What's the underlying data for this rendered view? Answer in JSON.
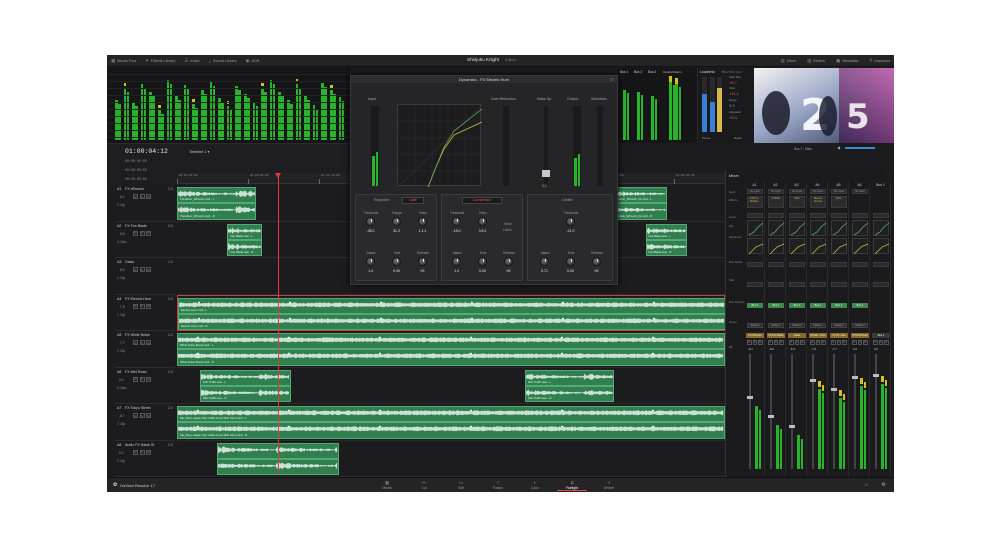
{
  "top_bar": {
    "left_items": [
      {
        "icon": "media-pool-icon",
        "label": "Media Pool"
      },
      {
        "icon": "effects-library-icon",
        "label": "Effects Library"
      },
      {
        "icon": "index-icon",
        "label": "Index"
      },
      {
        "icon": "sound-library-icon",
        "label": "Sound Library"
      },
      {
        "icon": "adr-icon",
        "label": "ADR"
      }
    ],
    "project_title": "Shinjuku Knight",
    "project_status": "Edited",
    "right_items": [
      {
        "icon": "mixer-icon",
        "label": "Mixer"
      },
      {
        "icon": "meters-icon",
        "label": "Meters"
      },
      {
        "icon": "metadata-icon",
        "label": "Metadata"
      },
      {
        "icon": "inspector-icon",
        "label": "Inspector"
      }
    ]
  },
  "timecode": {
    "main": "01:00:04:12",
    "timeline_label": "Timeline 1",
    "rows": [
      "00:00:00:00",
      "00:00:00:00",
      "00:00:00:00"
    ]
  },
  "ruler_ticks": [
    "01:00:00:00",
    "01:00:05:00",
    "01:00:10:00",
    "01:00:15:00",
    "01:00:20:00",
    "01:00:25:00",
    "01:00:30:00",
    "01:00:35:00",
    "01:00:40:00"
  ],
  "bus_labels": [
    "Bus 1",
    "Bus 2",
    "Bus 3",
    "Control Room"
  ],
  "loudness": {
    "title": "Loudness",
    "standard": "BS.1770-1 (LU)",
    "short_max_label": "Short Max",
    "short_max": "+8.7",
    "short_label": "Short",
    "short": "+11.2",
    "range_label": "Range",
    "range": "3.9",
    "integrated_label": "Integrated",
    "integrated": "+9.4",
    "pause": "Pause",
    "reset": "Reset"
  },
  "viewer_text": "Bus 1 · Main",
  "dynamics": {
    "title": "Dynamics - FX Electric Hum",
    "labels": {
      "input": "Input",
      "gain_reduction": "Gain Reduction",
      "make_up": "Make Up",
      "output": "Output",
      "sidechain": "Sidechain"
    },
    "makeup_value": "0.0",
    "sections": {
      "expander": {
        "title": "Expander",
        "gate": "Gate",
        "knobs": [
          {
            "label": "Threshold",
            "value": "-35.0"
          },
          {
            "label": "Range",
            "value": "31.2"
          },
          {
            "label": "Ratio",
            "value": "1.1:1"
          }
        ],
        "knobs2": [
          {
            "label": "Attack",
            "value": "1.4"
          },
          {
            "label": "Hold",
            "value": "0.00"
          },
          {
            "label": "Release",
            "value": "93"
          }
        ]
      },
      "compressor": {
        "title": "Compressor",
        "knobs": [
          {
            "label": "Threshold",
            "value": "-15.0"
          },
          {
            "label": "Ratio",
            "value": "3.5:1"
          }
        ],
        "send_label": "Send",
        "listen_label": "Listen",
        "knobs2": [
          {
            "label": "Attack",
            "value": "1.4"
          },
          {
            "label": "Hold",
            "value": "0.00"
          },
          {
            "label": "Release",
            "value": "93"
          }
        ]
      },
      "limiter": {
        "title": "Limiter",
        "knobs": [
          {
            "label": "Threshold",
            "value": "-21.0"
          }
        ],
        "knobs2": [
          {
            "label": "Attack",
            "value": "0.71"
          },
          {
            "label": "Hold",
            "value": "0.00"
          },
          {
            "label": "Release",
            "value": "93"
          }
        ]
      }
    }
  },
  "tracks": [
    {
      "id": "A1",
      "name": "FX Whoosh",
      "vol": "-8.1",
      "clips_label": "1 Clip",
      "ch": "2.0",
      "clips": [
        {
          "name": "Transition_Whoosh.mp3 - L",
          "start": 0,
          "end": 14.5,
          "half": "top"
        },
        {
          "name": "Transition_Whoosh.mp3 - R",
          "start": 0,
          "end": 14.5,
          "half": "bottom"
        },
        {
          "name": "Transition_Whoosh_02.mp3 - L",
          "start": 79,
          "end": 89.5,
          "half": "top"
        },
        {
          "name": "Transition_Whoosh_02.mp3 - R",
          "start": 79,
          "end": 89.5,
          "half": "bottom"
        }
      ]
    },
    {
      "id": "A2",
      "name": "FX Fan Blade",
      "vol": "-8.9",
      "clips_label": "4 Clips",
      "ch": "2.0",
      "clips": [
        {
          "name": "Fan Blade.wav - L",
          "start": 9.2,
          "end": 15.6,
          "half": "top"
        },
        {
          "name": "Fan Blade.wav - R",
          "start": 9.2,
          "end": 15.6,
          "half": "bottom"
        },
        {
          "name": "Fan Blade.wav - L",
          "start": 85.5,
          "end": 93,
          "half": "top"
        },
        {
          "name": "Fan Blade.wav - R",
          "start": 85.5,
          "end": 93,
          "half": "bottom"
        }
      ]
    },
    {
      "id": "A3",
      "name": "Glass",
      "vol": "-8.9",
      "clips_label": "1 Clip",
      "ch": "1.0",
      "clips": []
    },
    {
      "id": "A4",
      "name": "FX Electric Hum",
      "vol": "-7.8",
      "clips_label": "1 Clip",
      "ch": "2.0",
      "clips": [
        {
          "name": "Electric Hum.mp3 - L",
          "start": 0,
          "end": 100,
          "half": "top"
        },
        {
          "name": "Electric Hum.mp3 - R",
          "start": 0,
          "end": 100,
          "half": "bottom"
        }
      ]
    },
    {
      "id": "A5",
      "name": "FX White Noise",
      "vol": "-7.7",
      "clips_label": "1 Clip",
      "ch": "2.0",
      "clips": [
        {
          "name": "White Noise Boost.mp3 - L",
          "start": 0,
          "end": 100,
          "half": "top"
        },
        {
          "name": "White Noise Boost.mp3 - R",
          "start": 0,
          "end": 100,
          "half": "bottom"
        }
      ]
    },
    {
      "id": "A6",
      "name": "FX Wet Road",
      "vol": "0.0",
      "clips_label": "2 Clips",
      "ch": "2.0",
      "clips": [
        {
          "name": "Wet Traffic.wav - L",
          "start": 4.2,
          "end": 20.8,
          "half": "top"
        },
        {
          "name": "Wet Traffic.wav - R",
          "start": 4.2,
          "end": 20.8,
          "half": "bottom"
        },
        {
          "name": "Wet Traffic.wav - L",
          "start": 63.5,
          "end": 79.8,
          "half": "top"
        },
        {
          "name": "Wet Traffic.wav - R",
          "start": 63.5,
          "end": 79.8,
          "half": "bottom"
        }
      ]
    },
    {
      "id": "A7",
      "name": "FX Tokyo Street",
      "vol": "-6.7",
      "clips_label": "1 Clip",
      "ch": "2.0",
      "clips": [
        {
          "name": "SE_Tokyo Japan City Traffic Amos With Siren.mp3 - L",
          "start": 0,
          "end": 100,
          "half": "top"
        },
        {
          "name": "SE_Tokyo Japan City Traffic Amos With Siren.mp3 - R",
          "start": 0,
          "end": 100,
          "half": "bottom"
        }
      ]
    },
    {
      "id": "A8",
      "name": "Audio FX Hawk St",
      "vol": "0.0",
      "clips_label": "1 Clip",
      "ch": "2.0",
      "clips": [
        {
          "name": "",
          "start": 7.3,
          "end": 29.5,
          "half": "top"
        },
        {
          "name": "",
          "start": 7.3,
          "end": 29.5,
          "half": "bottom"
        }
      ]
    }
  ],
  "mixer": {
    "title": "Mixer",
    "row_labels": [
      "Input",
      "Effects",
      "Insert",
      "EQ",
      "Dynamics",
      "Bus Sends",
      "Pan",
      "Bus Outputs",
      "Group",
      "dB"
    ],
    "strips": [
      {
        "id": "A1",
        "input": "No Input",
        "effect": "AirDrop... Multiba...",
        "bus": "Bus 1",
        "group": "Group 1",
        "name": "FX Whoosh",
        "db": "-8.1",
        "level": 0.55
      },
      {
        "id": "A2",
        "input": "No Input",
        "effect": "AirFilter",
        "bus": "Bus 1",
        "group": "Group 1",
        "name": "FX Fan Blade",
        "db": "-8.9",
        "level": 0.38
      },
      {
        "id": "A3",
        "input": "No Input",
        "effect": "Pitch",
        "bus": "Bus 1",
        "group": "Group 1",
        "name": "Glass",
        "db": "-8.9",
        "level": 0.3
      },
      {
        "id": "A4",
        "input": "No Input",
        "effect": "Reverb Chorus",
        "bus": "Bus 1",
        "group": "Group 1",
        "name": "FX Ele...Hum",
        "db": "-7.8",
        "level": 0.7
      },
      {
        "id": "A5",
        "input": "No Input",
        "effect": "Echo",
        "bus": "Bus 1",
        "group": "Group 1",
        "name": "FX W...oise",
        "db": "-7.7",
        "level": 0.62
      },
      {
        "id": "A6",
        "input": "No Input",
        "effect": "",
        "bus": "Bus 1",
        "group": "Group 1",
        "name": "FX Wet Road",
        "db": "0.0",
        "level": 0.72
      },
      {
        "id": "Bus 1",
        "input": "",
        "effect": "",
        "bus": "",
        "group": "",
        "name": "Bus 1",
        "db": "0.0",
        "level": 0.74
      }
    ]
  },
  "pages": [
    {
      "icon": "media-page-icon",
      "label": "Media"
    },
    {
      "icon": "cut-page-icon",
      "label": "Cut"
    },
    {
      "icon": "edit-page-icon",
      "label": "Edit"
    },
    {
      "icon": "fusion-page-icon",
      "label": "Fusion"
    },
    {
      "icon": "color-page-icon",
      "label": "Color"
    },
    {
      "icon": "fairlight-page-icon",
      "label": "Fairlight",
      "active": true
    },
    {
      "icon": "deliver-page-icon",
      "label": "Deliver"
    }
  ],
  "brand": "DaVinci Resolve 17",
  "colors": {
    "clip": "#2f7f4f",
    "clip_border": "#56a877",
    "playhead": "#e03a3a",
    "meter_green": "#27b32a",
    "meter_yellow": "#d5bf20",
    "active_tab": "#e0453a"
  }
}
